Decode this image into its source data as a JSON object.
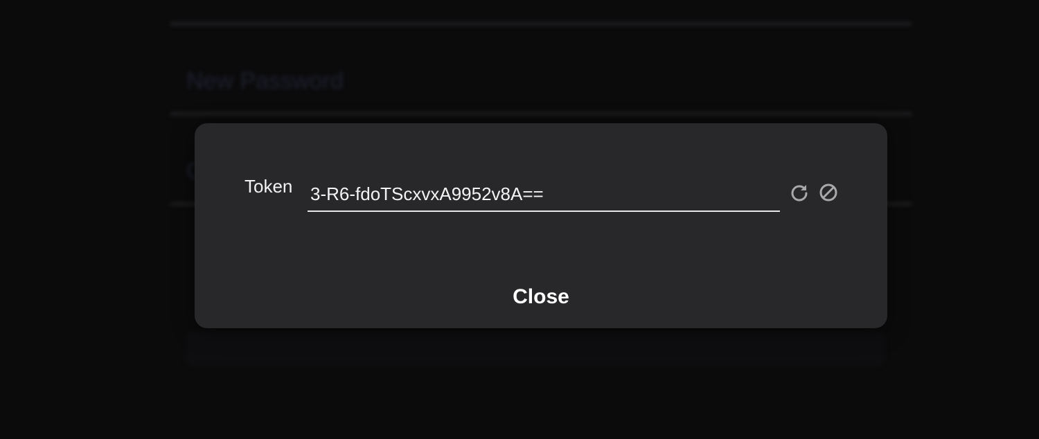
{
  "background": {
    "fields": [
      {
        "label": ""
      },
      {
        "label": "New Password"
      },
      {
        "label": "C"
      }
    ]
  },
  "modal": {
    "token_label": "Token",
    "token_value": "3-R6-fdoTScxvxA9952v8A==",
    "icons": {
      "refresh": "refresh-icon",
      "revoke": "block-icon"
    },
    "close_label": "Close"
  }
}
